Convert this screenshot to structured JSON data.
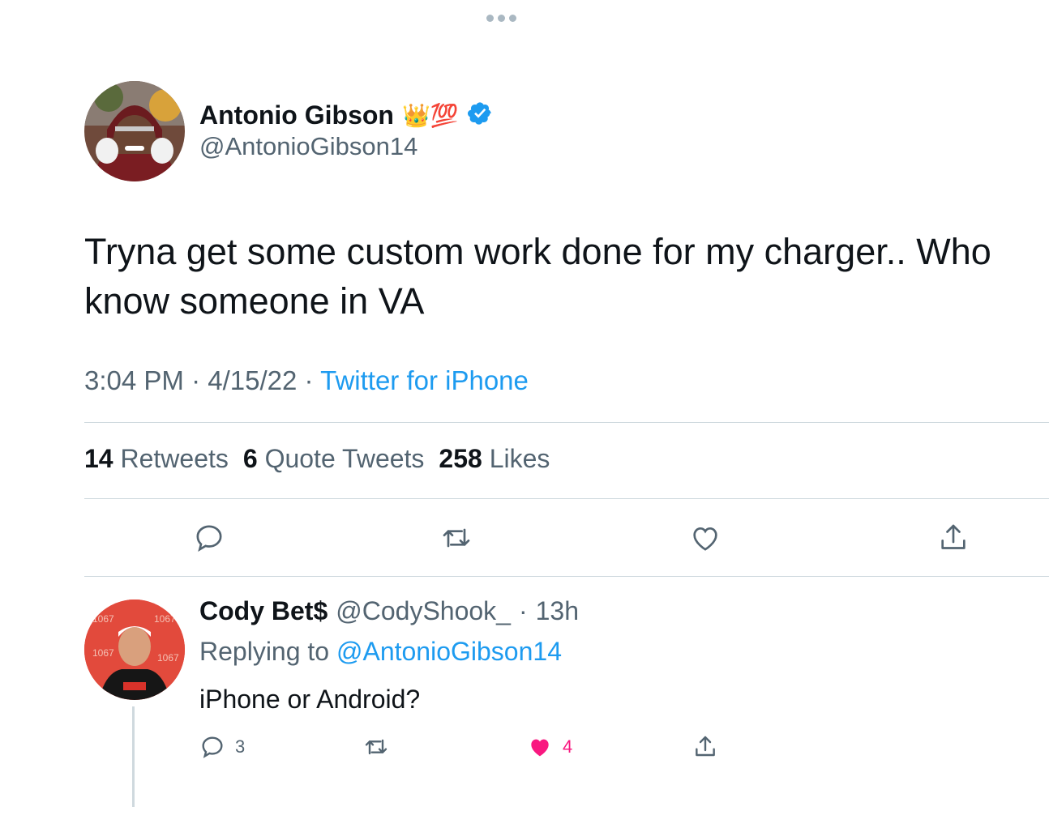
{
  "colors": {
    "accent": "#1d9bf0",
    "muted": "#536471",
    "like": "#f91880",
    "text": "#0f1419",
    "divider": "#cfd9de"
  },
  "tweet": {
    "author_name": "Antonio Gibson",
    "author_emoji": "👑💯",
    "handle": "@AntonioGibson14",
    "verified_icon": "verified-badge-icon",
    "text": "Tryna get some custom work done for my charger.. Who know someone in VA",
    "time": "3:04 PM",
    "date": "4/15/22",
    "source": "Twitter for iPhone",
    "sep": "·"
  },
  "stats": {
    "retweets_count": "14",
    "retweets_label": "Retweets",
    "quotes_count": "6",
    "quotes_label": "Quote Tweets",
    "likes_count": "258",
    "likes_label": "Likes"
  },
  "actions": {
    "reply_icon": "reply-icon",
    "retweet_icon": "retweet-icon",
    "like_icon": "heart-icon",
    "share_icon": "share-icon"
  },
  "reply": {
    "author_name": "Cody Bet$",
    "handle": "@CodyShook_",
    "sep": "·",
    "time": "13h",
    "replying_prefix": "Replying to",
    "replying_to": "@AntonioGibson14",
    "text": "iPhone or Android?",
    "reply_count": "3",
    "like_count": "4"
  }
}
